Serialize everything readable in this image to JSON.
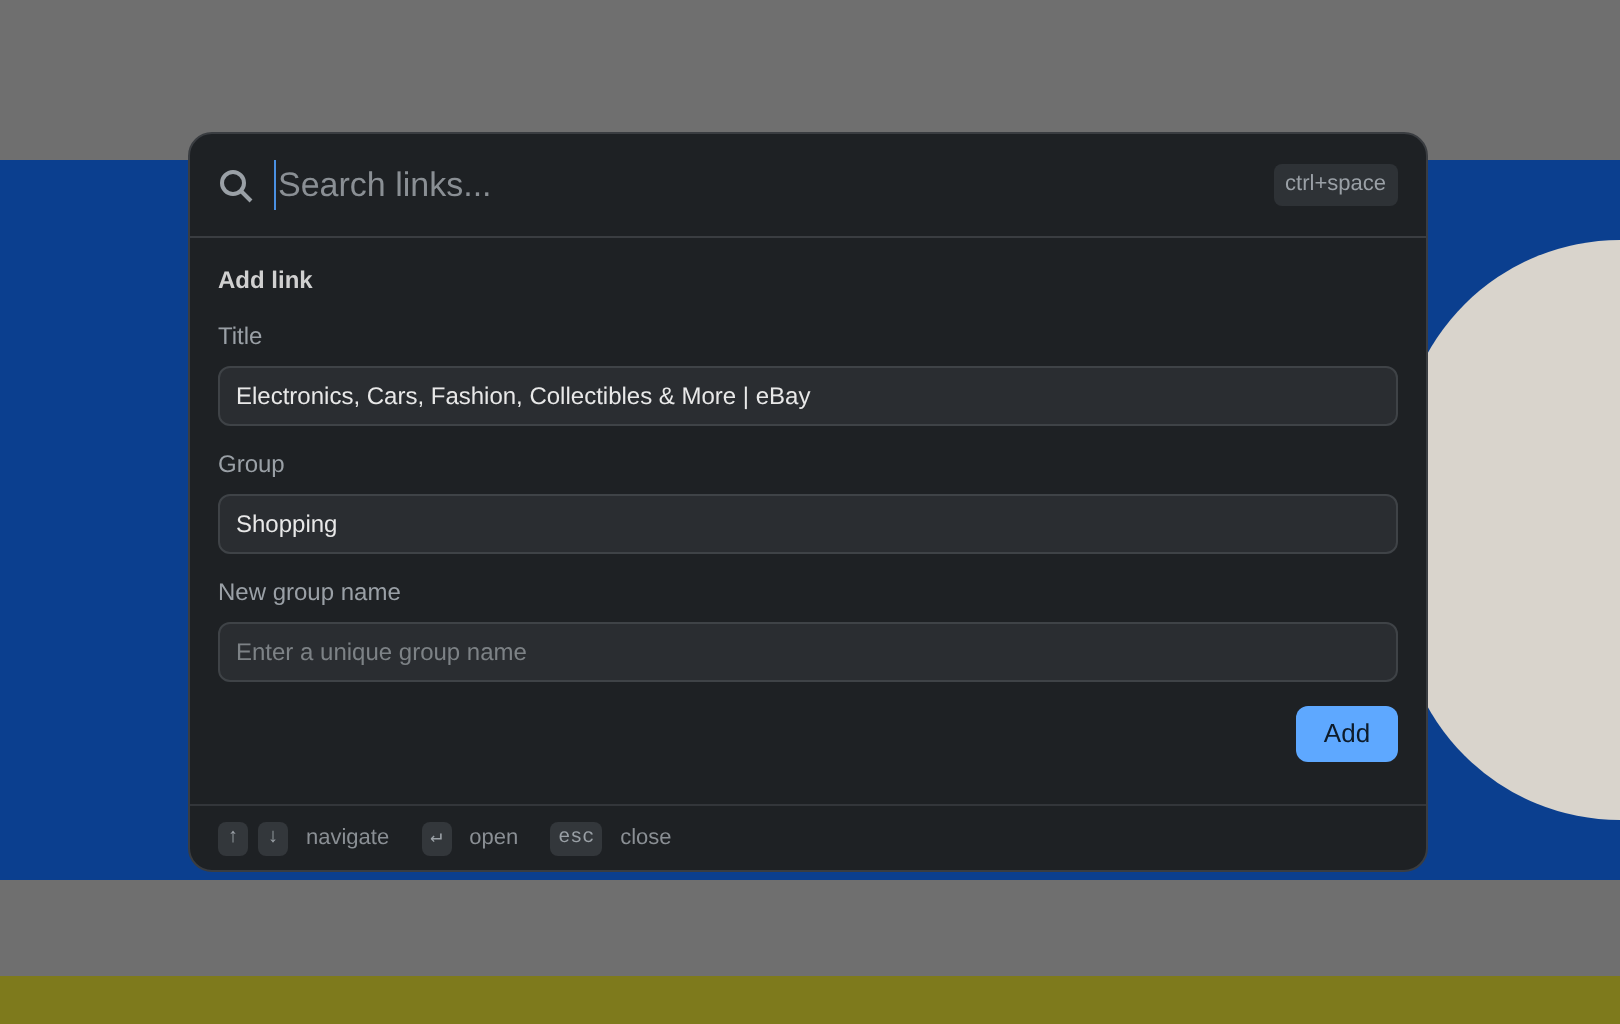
{
  "search": {
    "placeholder": "Search links...",
    "shortcut": "ctrl+space"
  },
  "form": {
    "heading": "Add link",
    "fields": [
      {
        "label": "Title",
        "value": "Electronics, Cars, Fashion, Collectibles & More | eBay"
      },
      {
        "label": "Group",
        "value": "Shopping"
      },
      {
        "label": "New group name",
        "placeholder": "Enter a unique group name"
      }
    ],
    "submit": "Add"
  },
  "footer": [
    {
      "keys": [
        "↑",
        "↓"
      ],
      "label": "navigate"
    },
    {
      "keys": [
        "↵"
      ],
      "label": "open"
    },
    {
      "keys": [
        "esc"
      ],
      "label": "close"
    }
  ]
}
